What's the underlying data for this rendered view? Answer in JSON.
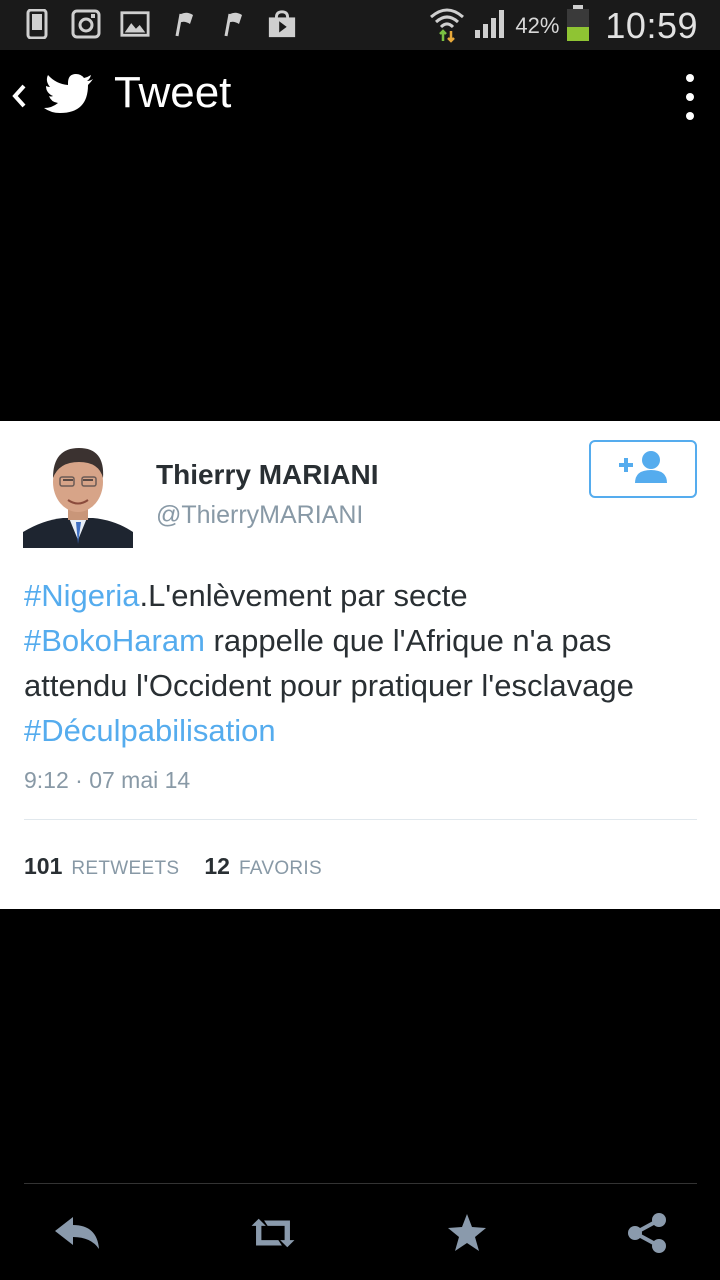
{
  "status_bar": {
    "battery_percent": "42%",
    "clock": "10:59",
    "icons": [
      "phone-icon",
      "instagram-icon",
      "gallery-icon",
      "flag-icon",
      "flag-icon",
      "play-store-icon",
      "wifi-icon",
      "signal-icon",
      "battery-icon"
    ]
  },
  "action_bar": {
    "title": "Tweet",
    "back_icon": "chevron-left-icon",
    "logo_icon": "twitter-bird-icon",
    "menu_icon": "overflow-menu-icon"
  },
  "tweet": {
    "author_name": "Thierry MARIANI",
    "author_handle": "@ThierryMARIANI",
    "follow_icon": "add-user-icon",
    "text_parts": {
      "h1": "#Nigeria",
      "t1": ".L'enlèvement par secte",
      "h2": "#BokoHaram",
      "t2": " rappelle que l'Afrique n'a pas attendu l'Occident pour pratiquer l'esclavage ",
      "h3": "#Déculpabilisation"
    },
    "timestamp": "9:12 · 07 mai 14",
    "retweets_count": "101",
    "retweets_label": "RETWEETS",
    "favorites_count": "12",
    "favorites_label": "FAVORIS"
  },
  "toolbar": {
    "items": [
      "reply-icon",
      "retweet-icon",
      "favorite-star-icon",
      "share-icon"
    ]
  },
  "colors": {
    "accent": "#55acee",
    "text": "#292f33",
    "muted": "#8899a6",
    "toolbar_icon": "#8a9aac"
  }
}
